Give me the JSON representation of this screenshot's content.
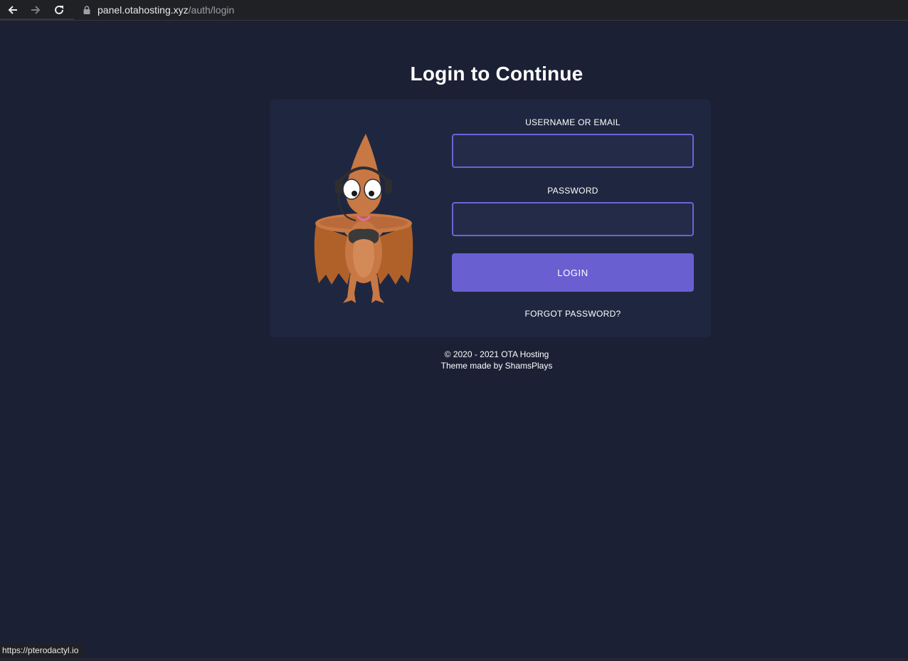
{
  "browser": {
    "url_host": "panel.otahosting.xyz",
    "url_path": "/auth/login",
    "status_url": "https://pterodactyl.io"
  },
  "login": {
    "title": "Login to Continue",
    "username_label": "USERNAME OR EMAIL",
    "username_value": "",
    "password_label": "PASSWORD",
    "password_value": "",
    "login_button": "LOGIN",
    "forgot_link": "FORGOT PASSWORD?"
  },
  "footer": {
    "copyright": "© 2020 - 2021 OTA Hosting",
    "credit": "Theme made by ShamsPlays"
  },
  "colors": {
    "background": "#1b2035",
    "card": "#1f2740",
    "accent": "#6a5fd1",
    "input_border": "#6c63d4"
  },
  "icons": [
    "back-arrow-icon",
    "forward-arrow-icon",
    "reload-icon",
    "lock-icon"
  ]
}
